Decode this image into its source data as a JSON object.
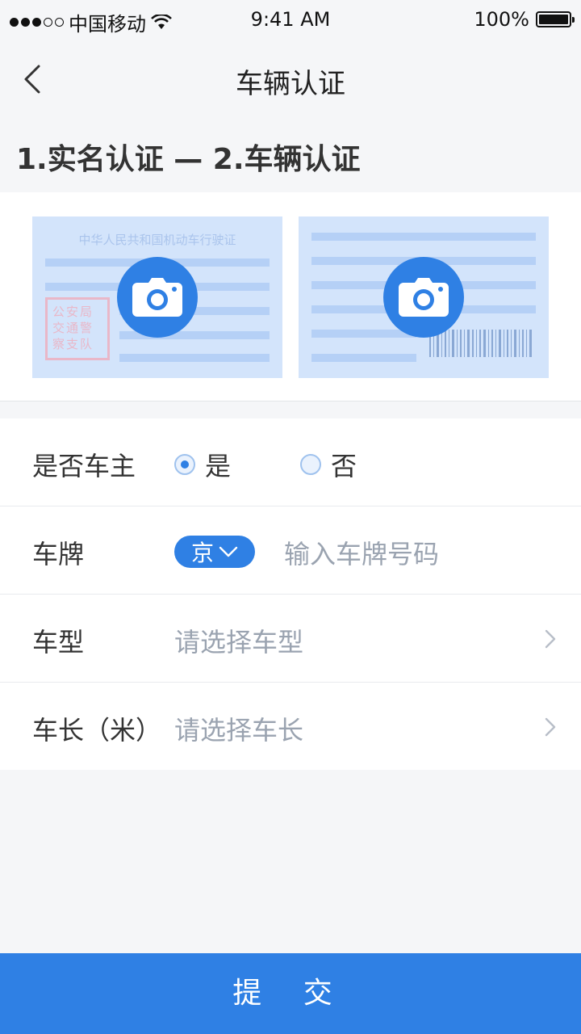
{
  "status_bar": {
    "carrier": "中国移动",
    "time": "9:41 AM",
    "battery": "100%"
  },
  "nav": {
    "title": "车辆认证",
    "back_icon": "chevron-left-icon"
  },
  "steps": {
    "text": "1.实名认证 — 2.车辆认证"
  },
  "photos": {
    "front_caption": "中华人民共和国机动车行驶证",
    "stamp_text": "公安局交通警察支队",
    "camera_icon": "camera-icon"
  },
  "form": {
    "owner": {
      "label": "是否车主",
      "options": [
        "是",
        "否"
      ],
      "selected": "是"
    },
    "plate": {
      "label": "车牌",
      "province": "京",
      "placeholder": "输入车牌号码"
    },
    "type": {
      "label": "车型",
      "placeholder": "请选择车型"
    },
    "length": {
      "label": "车长（米）",
      "placeholder": "请选择车长"
    }
  },
  "submit_label": "提 交",
  "colors": {
    "accent": "#2f80e4",
    "background": "#f5f6f8",
    "placeholder": "#9aa3b0"
  }
}
